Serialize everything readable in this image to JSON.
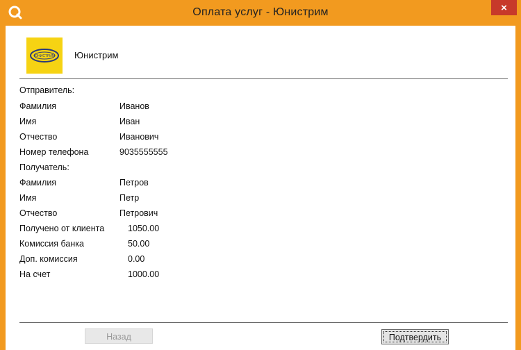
{
  "window": {
    "title": "Оплата услуг - Юнистрим",
    "close_label": "×"
  },
  "provider": {
    "name": "Юнистрим",
    "logo_text": "ЮНИСТРИМ"
  },
  "rows": [
    {
      "label": "Отправитель:",
      "value": ""
    },
    {
      "label": "Фамилия",
      "value": "Иванов"
    },
    {
      "label": "Имя",
      "value": "Иван"
    },
    {
      "label": "Отчество",
      "value": "Иванович"
    },
    {
      "label": "Номер телефона",
      "value": "9035555555"
    },
    {
      "label": "Получатель:",
      "value": ""
    },
    {
      "label": "Фамилия",
      "value": "Петров"
    },
    {
      "label": "Имя",
      "value": "Петр"
    },
    {
      "label": "Отчество",
      "value": "Петрович"
    },
    {
      "label": "Получено от клиента",
      "value": "1050.00"
    },
    {
      "label": "Комиссия банка",
      "value": "50.00"
    },
    {
      "label": "Доп. комиссия",
      "value": "0.00"
    },
    {
      "label": "На счет",
      "value": "1000.00"
    }
  ],
  "buttons": {
    "back_label": "Назад",
    "confirm_label": "Подтвердить"
  },
  "colors": {
    "frame": "#f29a1f",
    "close": "#c7392a",
    "logo_bg": "#f6d313"
  }
}
